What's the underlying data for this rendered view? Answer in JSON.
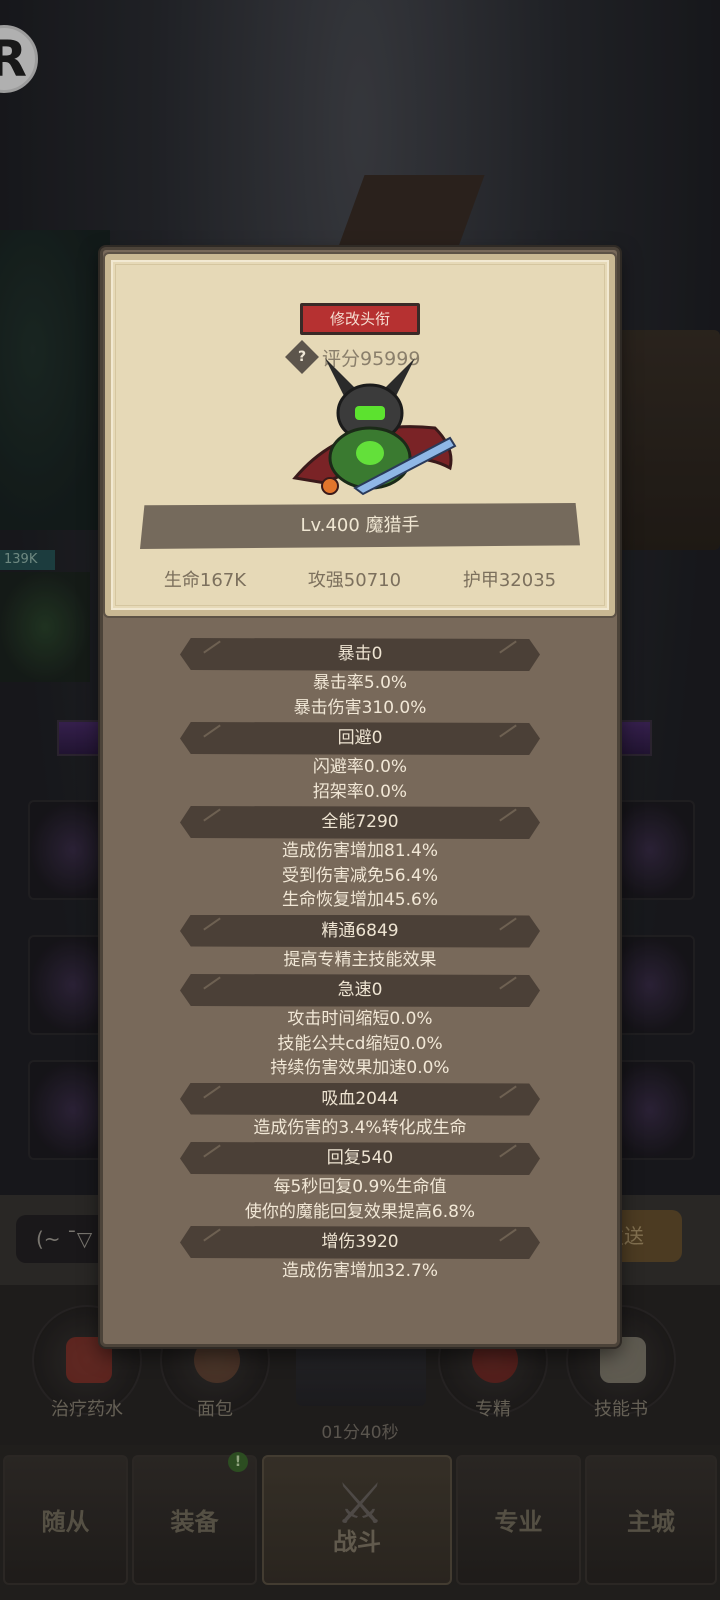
{
  "background": {
    "hp_label": "139K",
    "chat_placeholder": "(~ ¯▽",
    "send_label": "发送",
    "items": [
      {
        "label": "治疗药水",
        "icon": "potion-icon",
        "color": "#c23a2e"
      },
      {
        "label": "面包",
        "icon": "bread-icon",
        "color": "#8c5a3e"
      },
      {
        "label": "专精",
        "icon": "specialization-icon",
        "color": "#a82a22"
      },
      {
        "label": "技能书",
        "icon": "skill-book-icon",
        "color": "#c7c0a8"
      }
    ],
    "timer": "01分40秒",
    "nav": [
      {
        "label": "随从"
      },
      {
        "label": "装备",
        "badge": "!"
      },
      {
        "label": "战斗"
      },
      {
        "label": "专业"
      },
      {
        "label": "主城"
      }
    ]
  },
  "panel": {
    "title_button": "修改头衔",
    "score": "评分95999",
    "name": "Lv.400 魔猎手",
    "stats": [
      "生命167K",
      "攻强50710",
      "护甲32035"
    ],
    "attributes": [
      {
        "header": "暴击0",
        "lines": [
          "暴击率5.0%",
          "暴击伤害310.0%"
        ]
      },
      {
        "header": "回避0",
        "lines": [
          "闪避率0.0%",
          "招架率0.0%"
        ]
      },
      {
        "header": "全能7290",
        "lines": [
          "造成伤害增加81.4%",
          "受到伤害减免56.4%",
          "生命恢复增加45.6%"
        ]
      },
      {
        "header": "精通6849",
        "lines": [
          "提高专精主技能效果"
        ]
      },
      {
        "header": "急速0",
        "lines": [
          "攻击时间缩短0.0%",
          "技能公共cd缩短0.0%",
          "持续伤害效果加速0.0%"
        ]
      },
      {
        "header": "吸血2044",
        "lines": [
          "造成伤害的3.4%转化成生命"
        ]
      },
      {
        "header": "回复540",
        "lines": [
          "每5秒回复0.9%生命值",
          "使你的魔能回复效果提高6.8%"
        ]
      },
      {
        "header": "增伤3920",
        "lines": [
          "造成伤害增加32.7%"
        ]
      }
    ]
  }
}
